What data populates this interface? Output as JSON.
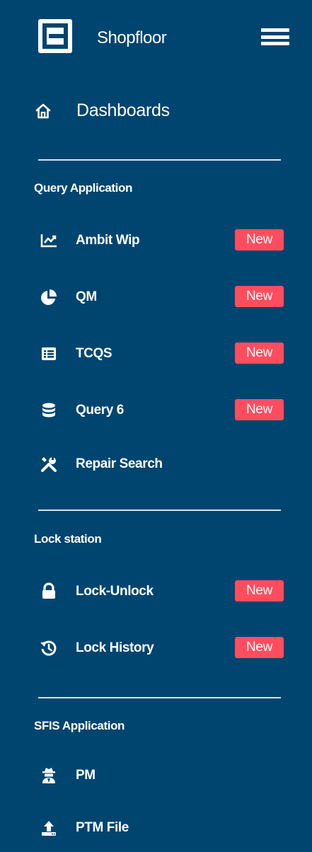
{
  "header": {
    "app_title": "Shopfloor",
    "logo_icon": "shopfloor-logo",
    "menu_icon": "hamburger-icon"
  },
  "dashboards": {
    "label": "Dashboards",
    "icon": "home-icon"
  },
  "sections": [
    {
      "heading": "Query Application",
      "items": [
        {
          "label": "Ambit Wip",
          "icon": "line-chart-icon",
          "badge": "New"
        },
        {
          "label": "QM",
          "icon": "pie-chart-icon",
          "badge": "New"
        },
        {
          "label": "TCQS",
          "icon": "list-table-icon",
          "badge": "New"
        },
        {
          "label": "Query 6",
          "icon": "database-icon",
          "badge": "New"
        },
        {
          "label": "Repair Search",
          "icon": "tools-icon",
          "badge": ""
        }
      ]
    },
    {
      "heading": "Lock station",
      "items": [
        {
          "label": "Lock-Unlock",
          "icon": "lock-icon",
          "badge": "New"
        },
        {
          "label": "Lock History",
          "icon": "history-icon",
          "badge": "New"
        }
      ]
    },
    {
      "heading": "SFIS Application",
      "items": [
        {
          "label": "PM",
          "icon": "user-secret-icon",
          "badge": ""
        },
        {
          "label": "PTM File",
          "icon": "upload-icon",
          "badge": ""
        }
      ]
    }
  ],
  "colors": {
    "sidebar_background": "#004570",
    "badge_background": "#ff4d5e",
    "text": "#ffffff"
  }
}
